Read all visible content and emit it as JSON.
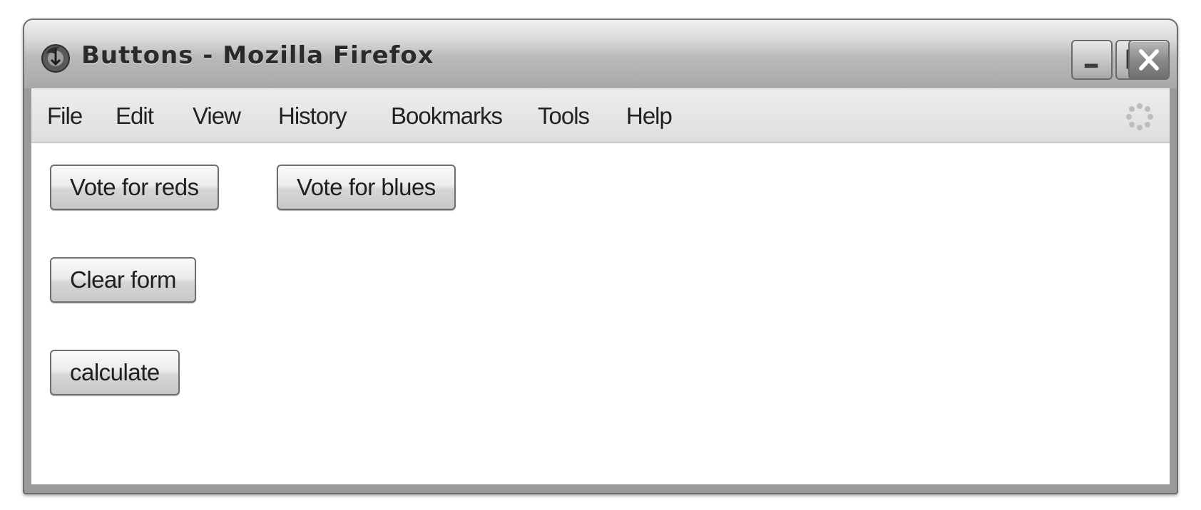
{
  "window": {
    "title": "Buttons - Mozilla Firefox"
  },
  "titlebar_buttons": {
    "minimize_icon": "minimize-icon",
    "maximize_icon": "maximize-icon",
    "close_icon": "close-icon"
  },
  "menu": {
    "items": [
      {
        "label": "File"
      },
      {
        "label": "Edit"
      },
      {
        "label": "View"
      },
      {
        "label": "History"
      },
      {
        "label": "Bookmarks"
      },
      {
        "label": "Tools"
      },
      {
        "label": "Help"
      }
    ]
  },
  "page": {
    "vote_reds_label": "Vote for reds",
    "vote_blues_label": "Vote for blues",
    "clear_form_label": "Clear form",
    "calculate_label": "calculate"
  },
  "icons": {
    "app": "firefox-icon",
    "throbber": "throbber-icon"
  }
}
